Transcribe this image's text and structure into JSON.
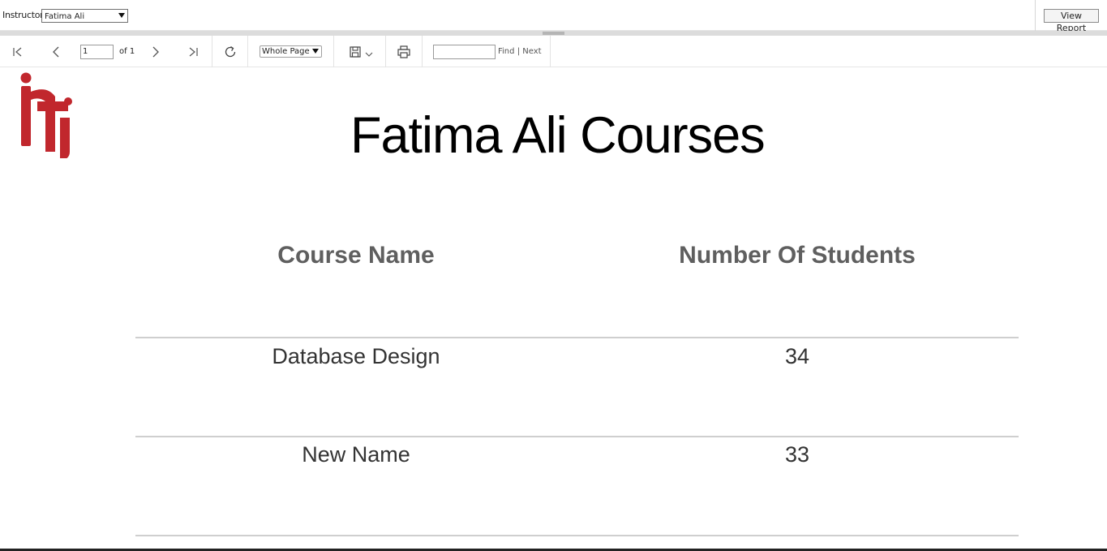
{
  "params": {
    "instructor_label": "Instructor",
    "instructor_value": "Fatima Ali",
    "view_report_label": "View Report"
  },
  "toolbar": {
    "page_value": "1",
    "page_of": "of 1",
    "zoom_value": "Whole Page",
    "find_label": "Find",
    "find_separator": "|",
    "next_label": "Next"
  },
  "report": {
    "title": "Fatima Ali Courses",
    "columns": [
      "Course Name",
      "Number Of Students"
    ],
    "rows": [
      [
        "Database Design",
        "34"
      ],
      [
        "New Name",
        "33"
      ]
    ]
  },
  "colors": {
    "logo_red": "#c1272d",
    "header_gray": "#5f5f5f"
  }
}
